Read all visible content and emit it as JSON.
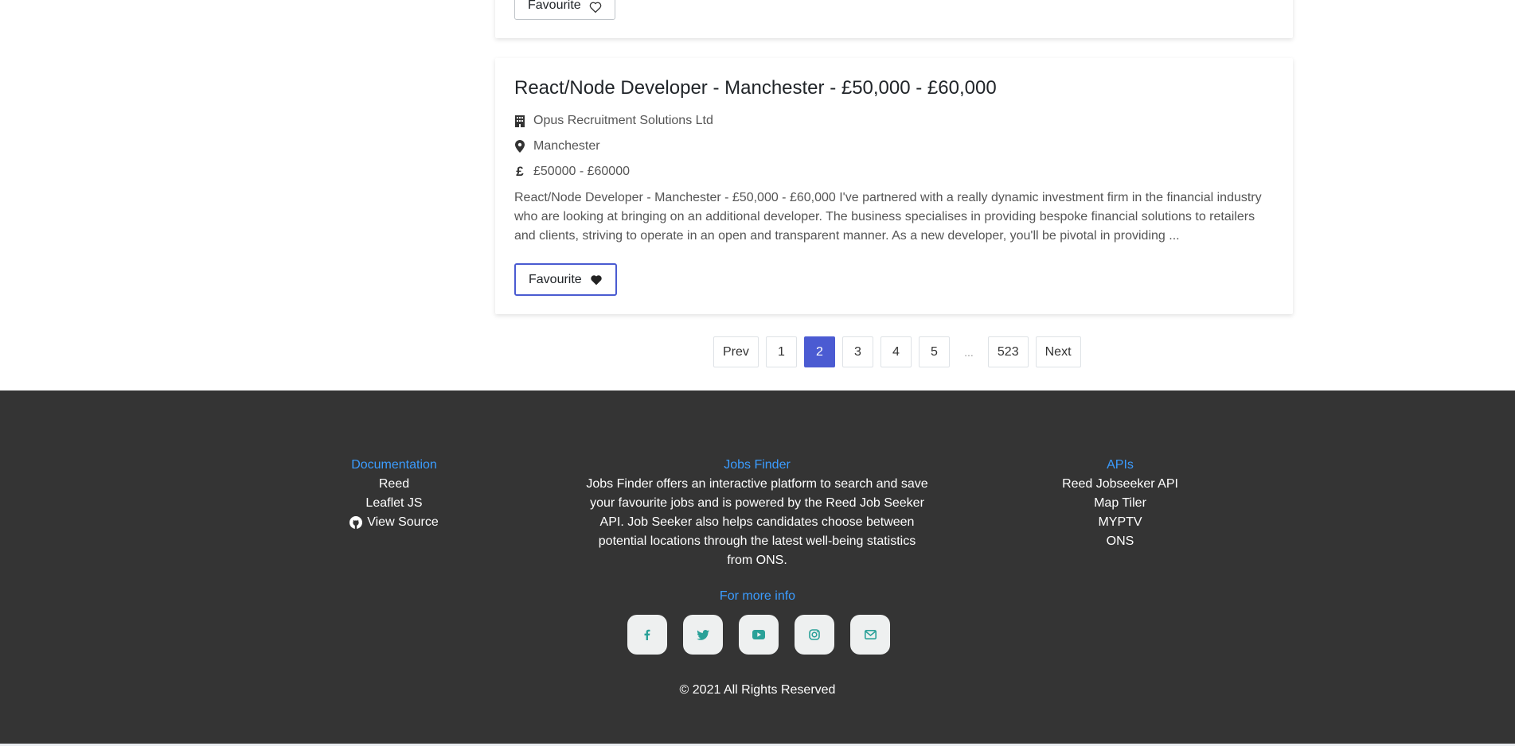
{
  "previous_card": {
    "favourite_label": "Favourite"
  },
  "job": {
    "title": "React/Node Developer - Manchester - £50,000 - £60,000",
    "company": "Opus Recruitment Solutions Ltd",
    "location": "Manchester",
    "currency_symbol": "£",
    "salary": "£50000 - £60000",
    "description": "React/Node Developer - Manchester - £50,000 - £60,000 I've partnered with a really dynamic investment firm in the financial industry who are looking at bringing on an additional developer. The business specialises in providing bespoke financial solutions to retailers and clients, striving to operate in an open and transparent manner. As a new developer, you'll be pivotal in providing ...",
    "favourite_label": "Favourite"
  },
  "pagination": {
    "prev": "Prev",
    "pages": [
      "1",
      "2",
      "3",
      "4",
      "5"
    ],
    "active_page": "2",
    "ellipsis": "...",
    "last": "523",
    "next": "Next"
  },
  "footer": {
    "documentation": {
      "heading": "Documentation",
      "links": [
        "Reed",
        "Leaflet JS",
        "View Source"
      ]
    },
    "about": {
      "heading": "Jobs Finder",
      "text": "Jobs Finder offers an interactive platform to search and save your favourite jobs and is powered by the Reed Job Seeker API. Job Seeker also helps candidates choose between potential locations through the latest well-being statistics from ONS."
    },
    "apis": {
      "heading": "APIs",
      "links": [
        "Reed Jobseeker API",
        "Map Tiler",
        "MYPTV",
        "ONS"
      ]
    },
    "more_info": "For more info",
    "social_icons": [
      "facebook-icon",
      "twitter-icon",
      "youtube-icon",
      "instagram-icon",
      "envelope-icon"
    ],
    "copyright": "© 2021 All Rights Reserved"
  },
  "colors": {
    "accent": "#4b5bd2",
    "footer_bg": "#343434",
    "footer_heading": "#3b9cff",
    "social_icon": "#2aa198"
  }
}
